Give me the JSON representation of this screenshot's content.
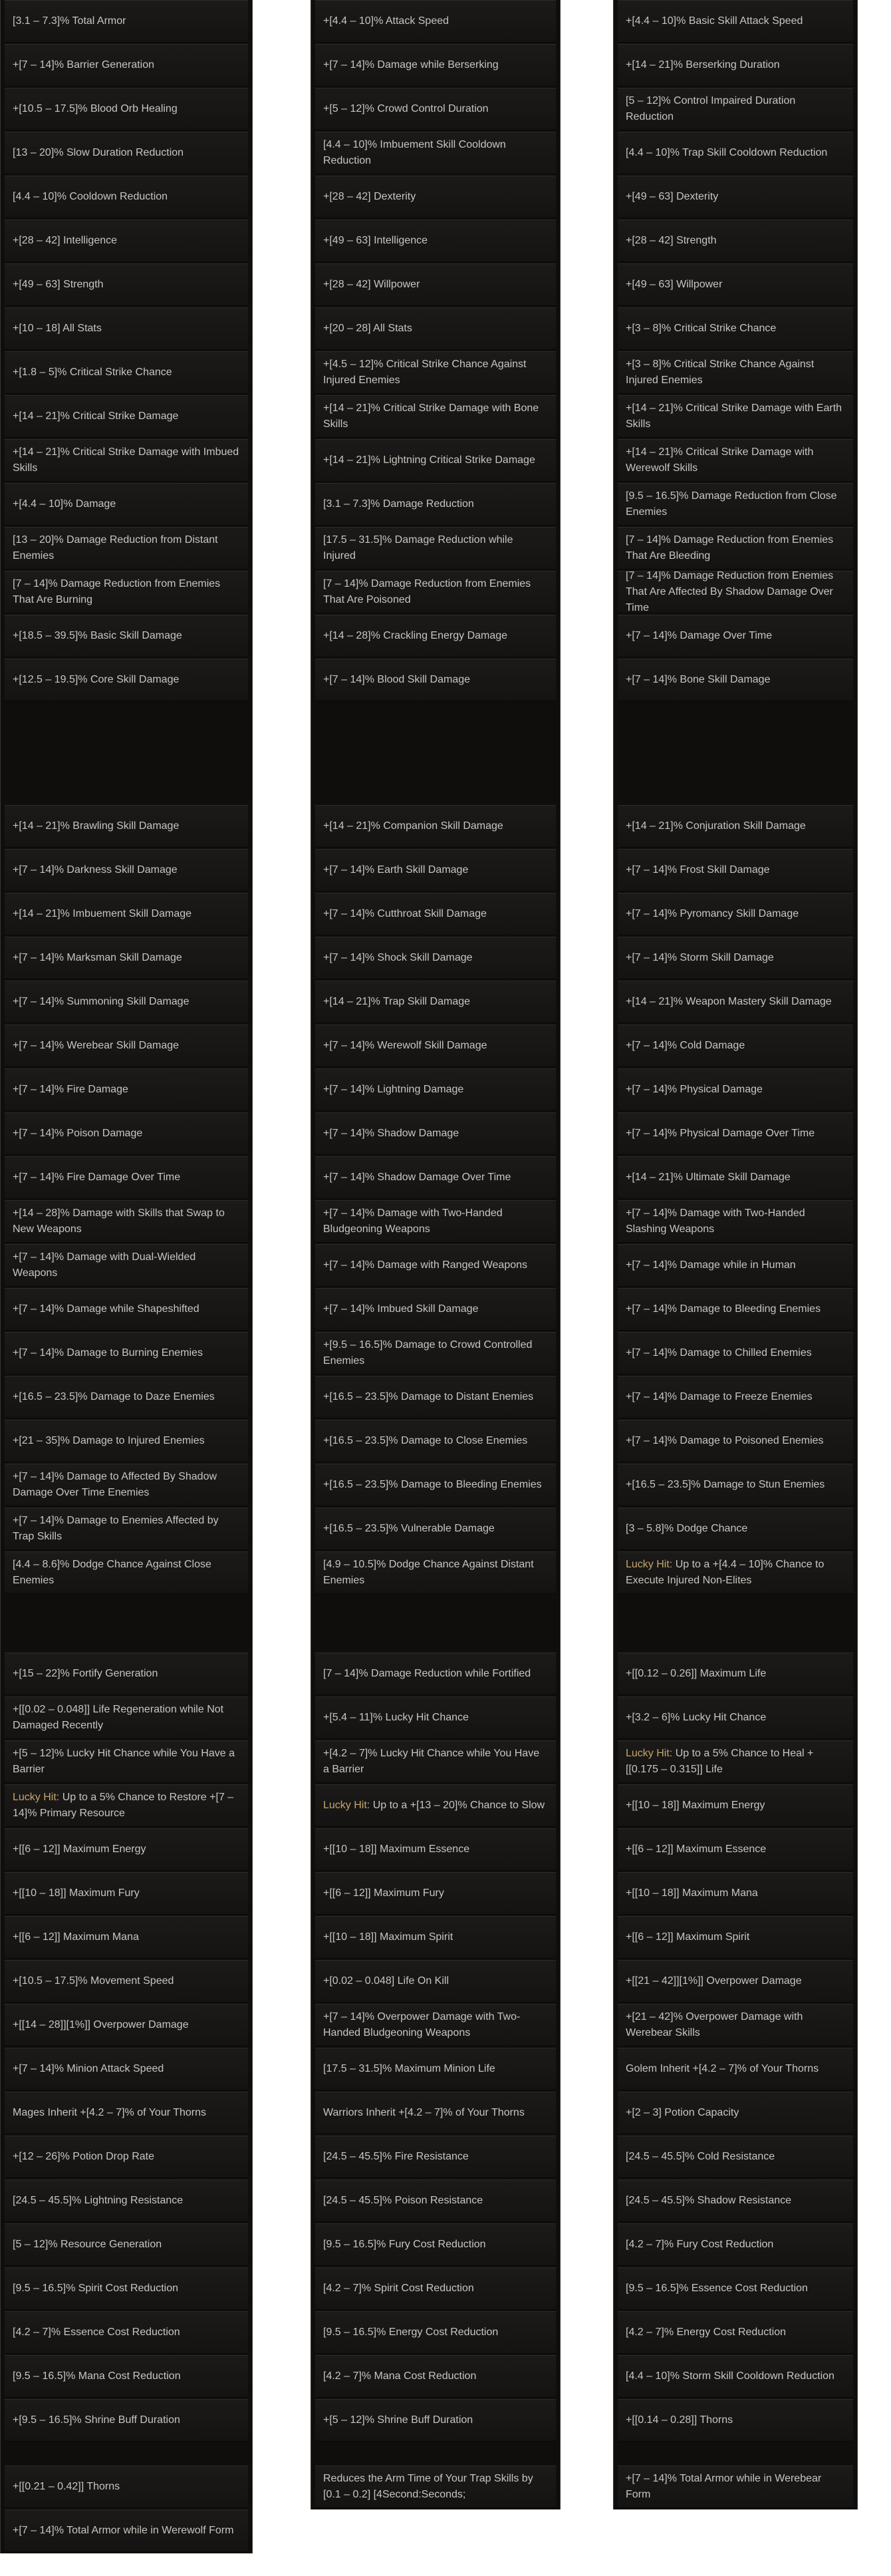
{
  "colors": {
    "panel_bg": "#0f0e0d",
    "row_bg": "#1b1a19",
    "text": "#c9c5c0",
    "lucky_hit_label": "#c6a56b"
  },
  "blocks": [
    {
      "columns": [
        [
          "[3.1 – 7.3]% Total Armor",
          "+[7 – 14]% Barrier Generation",
          "+[10.5 – 17.5]% Blood Orb Healing",
          "[13 – 20]% Slow Duration Reduction",
          "[4.4 – 10]% Cooldown Reduction",
          "+[28 – 42] Intelligence",
          "+[49 – 63] Strength",
          "+[10 – 18] All Stats",
          "+[1.8 – 5]% Critical Strike Chance",
          "+[14 – 21]% Critical Strike Damage",
          "+[14 – 21]% Critical Strike Damage with Imbued Skills",
          "+[4.4 – 10]% Damage",
          "[13 – 20]% Damage Reduction from Distant Enemies",
          "[7 – 14]% Damage Reduction from Enemies That Are Burning",
          "+[18.5 – 39.5]% Basic Skill Damage",
          "+[12.5 – 19.5]% Core Skill Damage"
        ],
        [
          "+[4.4 – 10]% Attack Speed",
          "+[7 – 14]% Damage while Berserking",
          "+[5 – 12]% Crowd Control Duration",
          "[4.4 – 10]% Imbuement Skill Cooldown Reduction",
          "+[28 – 42] Dexterity",
          "+[49 – 63] Intelligence",
          "+[28 – 42] Willpower",
          "+[20 – 28] All Stats",
          "+[4.5 – 12]% Critical Strike Chance Against Injured Enemies",
          "+[14 – 21]% Critical Strike Damage with Bone Skills",
          "+[14 – 21]% Lightning Critical Strike Damage",
          "[3.1 – 7.3]% Damage Reduction",
          "[17.5 – 31.5]% Damage Reduction while Injured",
          "[7 – 14]% Damage Reduction from Enemies That Are Poisoned",
          "+[14 – 28]% Crackling Energy Damage",
          "+[7 – 14]% Blood Skill Damage"
        ],
        [
          "+[4.4 – 10]% Basic Skill Attack Speed",
          "+[14 – 21]% Berserking Duration",
          "[5 – 12]% Control Impaired Duration Reduction",
          "[4.4 – 10]% Trap Skill Cooldown Reduction",
          "+[49 – 63] Dexterity",
          "+[28 – 42] Strength",
          "+[49 – 63] Willpower",
          "+[3 – 8]% Critical Strike Chance",
          "+[3 – 8]% Critical Strike Chance Against Injured Enemies",
          "+[14 – 21]% Critical Strike Damage with Earth Skills",
          "+[14 – 21]% Critical Strike Damage with Werewolf Skills",
          "[9.5 – 16.5]% Damage Reduction from Close Enemies",
          "[7 – 14]% Damage Reduction from Enemies That Are Bleeding",
          "[7 – 14]% Damage Reduction from Enemies That Are Affected By Shadow Damage Over Time",
          "+[7 – 14]% Damage Over Time",
          "+[7 – 14]% Bone Skill Damage"
        ]
      ]
    },
    {
      "columns": [
        [
          "+[14 – 21]% Brawling Skill Damage",
          "+[7 – 14]% Darkness Skill Damage",
          "+[14 – 21]% Imbuement Skill Damage",
          "+[7 – 14]% Marksman Skill Damage",
          "+[7 – 14]% Summoning Skill Damage",
          "+[7 – 14]% Werebear Skill Damage",
          "+[7 – 14]% Fire Damage",
          "+[7 – 14]% Poison Damage",
          "+[7 – 14]% Fire Damage Over Time",
          "+[14 – 28]% Damage with Skills that Swap to New Weapons",
          "+[7 – 14]% Damage with Dual-Wielded Weapons",
          "+[7 – 14]% Damage while Shapeshifted",
          "+[7 – 14]% Damage to Burning Enemies",
          "+[16.5 – 23.5]% Damage to Daze Enemies",
          "+[21 – 35]% Damage to Injured Enemies",
          "+[7 – 14]% Damage to Affected By Shadow Damage Over Time Enemies",
          "+[7 – 14]% Damage to Enemies Affected by Trap Skills",
          "[4.4 – 8.6]% Dodge Chance Against Close Enemies"
        ],
        [
          "+[14 – 21]% Companion Skill Damage",
          "+[7 – 14]% Earth Skill Damage",
          "+[7 – 14]% Cutthroat Skill Damage",
          "+[7 – 14]% Shock Skill Damage",
          "+[14 – 21]% Trap Skill Damage",
          "+[7 – 14]% Werewolf Skill Damage",
          "+[7 – 14]% Lightning Damage",
          "+[7 – 14]% Shadow Damage",
          "+[7 – 14]% Shadow Damage Over Time",
          "+[7 – 14]% Damage with Two-Handed Bludgeoning Weapons",
          "+[7 – 14]% Damage with Ranged Weapons",
          "+[7 – 14]% Imbued Skill Damage",
          "+[9.5 – 16.5]% Damage to Crowd Controlled Enemies",
          "+[16.5 – 23.5]% Damage to Distant Enemies",
          "+[16.5 – 23.5]% Damage to Close Enemies",
          "+[16.5 – 23.5]% Damage to Bleeding Enemies",
          "+[16.5 – 23.5]% Vulnerable Damage",
          "[4.9 – 10.5]% Dodge Chance Against Distant Enemies"
        ],
        [
          "+[14 – 21]% Conjuration Skill Damage",
          "+[7 – 14]% Frost Skill Damage",
          "+[7 – 14]% Pyromancy Skill Damage",
          "+[7 – 14]% Storm Skill Damage",
          "+[14 – 21]% Weapon Mastery Skill Damage",
          "+[7 – 14]% Cold Damage",
          "+[7 – 14]% Physical Damage",
          "+[7 – 14]% Physical Damage Over Time",
          "+[14 – 21]% Ultimate Skill Damage",
          "+[7 – 14]% Damage with Two-Handed Slashing Weapons",
          "+[7 – 14]% Damage while in Human",
          "+[7 – 14]% Damage to Bleeding Enemies",
          "+[7 – 14]% Damage to Chilled Enemies",
          "+[7 – 14]% Damage to Freeze Enemies",
          "+[7 – 14]% Damage to Poisoned Enemies",
          "+[16.5 – 23.5]% Damage to Stun Enemies",
          "[3 – 5.8]% Dodge Chance",
          "Lucky Hit: Up to a +[4.4 – 10]% Chance to Execute Injured Non-Elites"
        ]
      ]
    },
    {
      "columns": [
        [
          "+[15 – 22]% Fortify Generation",
          "+[[0.02 – 0.048]] Life Regeneration while Not Damaged Recently",
          "+[5 – 12]% Lucky Hit Chance while You Have a Barrier",
          "Lucky Hit: Up to a 5% Chance to Restore +[7 – 14]% Primary Resource",
          "+[[6 – 12]] Maximum Energy",
          "+[[10 – 18]] Maximum Fury",
          "+[[6 – 12]] Maximum Mana",
          "+[10.5 – 17.5]% Movement Speed",
          "+[[14 – 28]][1%]] Overpower Damage",
          "+[7 – 14]% Minion Attack Speed",
          "Mages Inherit +[4.2 – 7]% of Your Thorns",
          "+[12 – 26]% Potion Drop Rate",
          "[24.5 – 45.5]% Lightning Resistance",
          "[5 – 12]% Resource Generation",
          "[9.5 – 16.5]% Spirit Cost Reduction",
          "[4.2 – 7]% Essence Cost Reduction",
          "[9.5 – 16.5]% Mana Cost Reduction",
          "+[9.5 – 16.5]% Shrine Buff Duration"
        ],
        [
          "[7 – 14]% Damage Reduction while Fortified",
          "+[5.4 – 11]% Lucky Hit Chance",
          "+[4.2 – 7]% Lucky Hit Chance while You Have a Barrier",
          "Lucky Hit: Up to a +[13 – 20]% Chance to Slow",
          "+[[10 – 18]] Maximum Essence",
          "+[[6 – 12]] Maximum Fury",
          "+[[10 – 18]] Maximum Spirit",
          "+[0.02 – 0.048] Life On Kill",
          "+[7 – 14]% Overpower Damage with Two-Handed Bludgeoning Weapons",
          "[17.5 – 31.5]% Maximum Minion Life",
          "Warriors Inherit +[4.2 – 7]% of Your Thorns",
          "[24.5 – 45.5]% Fire Resistance",
          "[24.5 – 45.5]% Poison Resistance",
          "[9.5 – 16.5]% Fury Cost Reduction",
          "[4.2 – 7]% Spirit Cost Reduction",
          "[9.5 – 16.5]% Energy Cost Reduction",
          "[4.2 – 7]% Mana Cost Reduction",
          "+[5 – 12]% Shrine Buff Duration"
        ],
        [
          "+[[0.12 – 0.26]] Maximum Life",
          "+[3.2 – 6]% Lucky Hit Chance",
          "Lucky Hit: Up to a 5% Chance to Heal +[[0.175 – 0.315]] Life",
          "+[[10 – 18]] Maximum Energy",
          "+[[6 – 12]] Maximum Essence",
          "+[[10 – 18]] Maximum Mana",
          "+[[6 – 12]] Maximum Spirit",
          "+[[21 – 42]][1%]] Overpower Damage",
          "+[21 – 42]% Overpower Damage with Werebear Skills",
          "Golem Inherit +[4.2 – 7]% of Your Thorns",
          "+[2 – 3] Potion Capacity",
          "[24.5 – 45.5]% Cold Resistance",
          "[24.5 – 45.5]% Shadow Resistance",
          "[4.2 – 7]% Fury Cost Reduction",
          "[9.5 – 16.5]% Essence Cost Reduction",
          "[4.2 – 7]% Energy Cost Reduction",
          "[4.4 – 10]% Storm Skill Cooldown Reduction",
          "+[[0.14 – 0.28]] Thorns"
        ]
      ]
    },
    {
      "columns": [
        [
          "+[[0.21 – 0.42]] Thorns",
          "+[7 – 14]% Total Armor while in Werewolf Form"
        ],
        [
          "Reduces the Arm Time of Your Trap Skills by [0.1 – 0.2] [4Second:Seconds;"
        ],
        [
          "+[7 – 14]% Total Armor while in Werebear Form"
        ]
      ]
    }
  ]
}
